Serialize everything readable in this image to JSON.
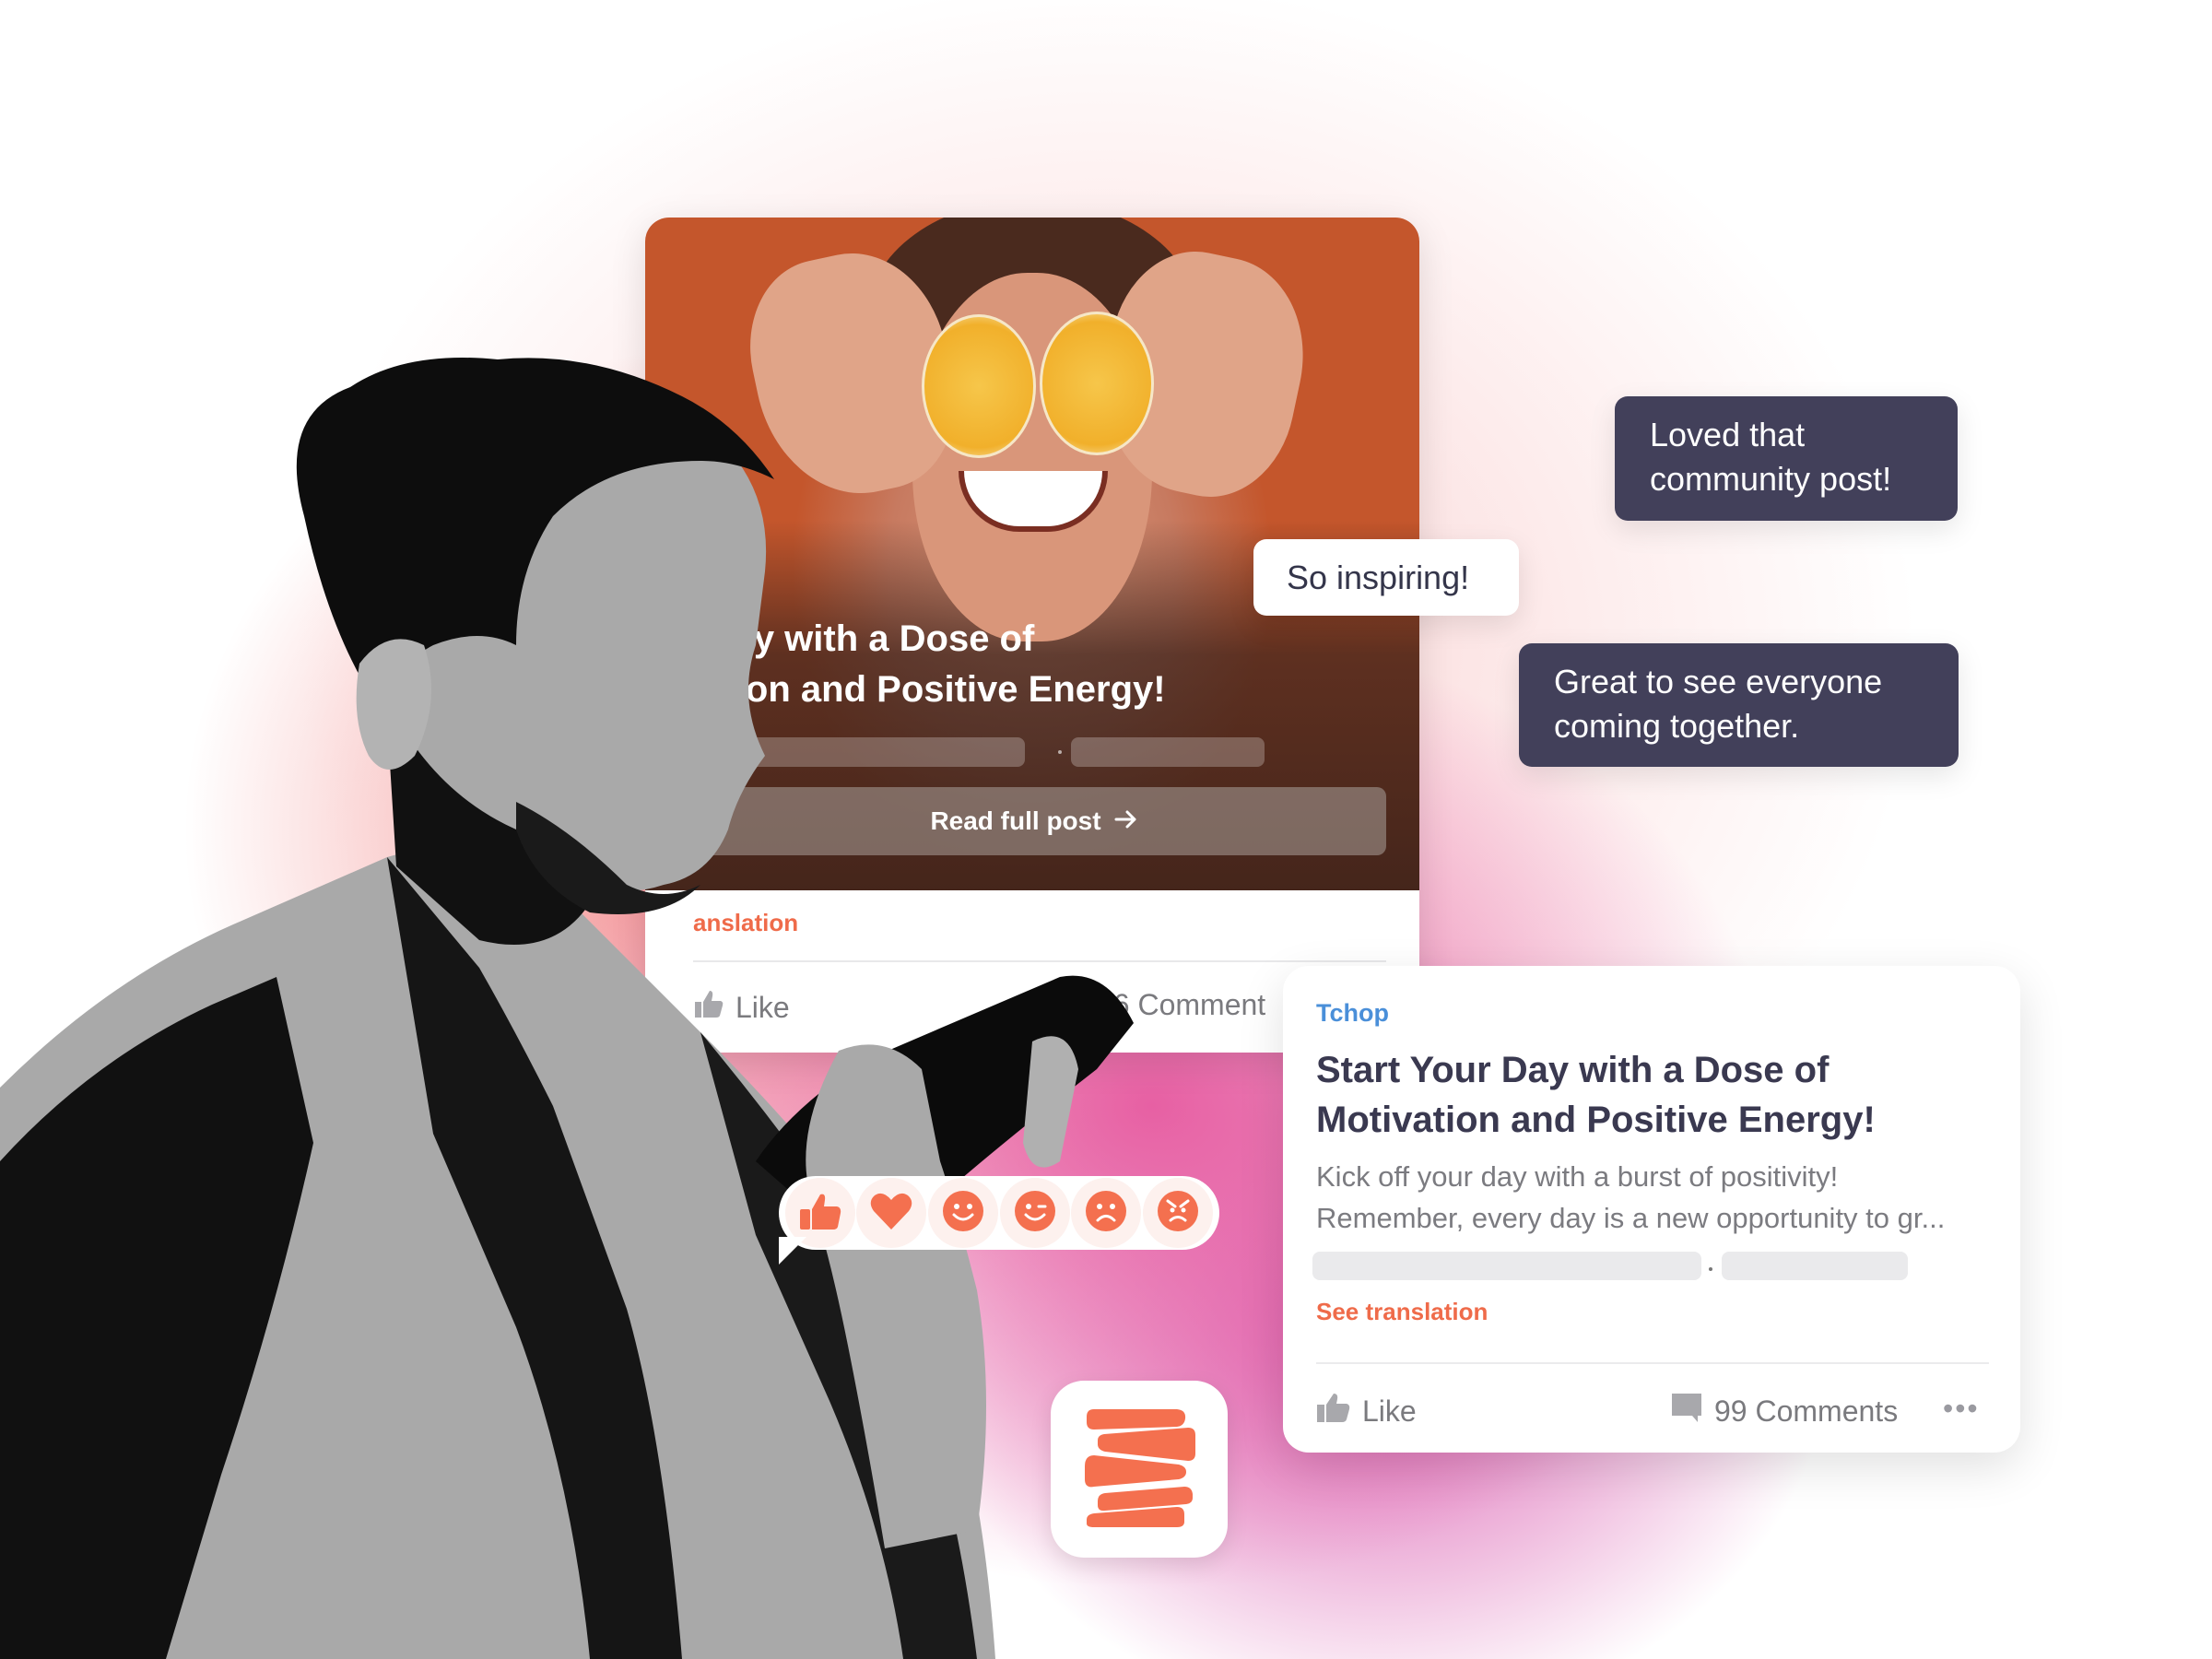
{
  "colors": {
    "accent_orange": "#ef6b4a",
    "brand_blue": "#4a8fd9",
    "bubble_dark": "#42405a",
    "title_dark": "#3a3950",
    "reaction_orange": "#f4704f"
  },
  "top_card": {
    "title_line1": "r Day with a Dose of",
    "title_line2": "vation and Positive Energy!",
    "read_button": "Read full post",
    "read_button_icon": "arrow-right-icon",
    "translation_link": "anslation",
    "like_label": "Like",
    "comments_label": "06 Comment"
  },
  "bubbles": [
    {
      "text": "So inspiring!",
      "style": "light"
    },
    {
      "line1": "Loved that",
      "line2": "community post!",
      "style": "dark"
    },
    {
      "line1": "Great to see everyone",
      "line2": "coming together.",
      "style": "dark"
    }
  ],
  "post_card": {
    "brand": "Tchop",
    "title_line1": "Start Your Day with a Dose of",
    "title_line2": "Motivation and Positive Energy!",
    "excerpt_line1": "Kick off your day with a burst of positivity!",
    "excerpt_line2": "Remember, every day is a new opportunity to gr...",
    "translation_link": "See translation",
    "like_label": "Like",
    "comments_label": "99 Comments",
    "more_label": "•••"
  },
  "reactions": [
    {
      "name": "like",
      "icon": "thumbs-up-icon"
    },
    {
      "name": "love",
      "icon": "heart-icon"
    },
    {
      "name": "happy",
      "icon": "smile-icon"
    },
    {
      "name": "wink",
      "icon": "wink-icon"
    },
    {
      "name": "sad",
      "icon": "sad-icon"
    },
    {
      "name": "angry",
      "icon": "angry-icon"
    }
  ],
  "app_icon": {
    "name": "tchop-logo-icon"
  }
}
